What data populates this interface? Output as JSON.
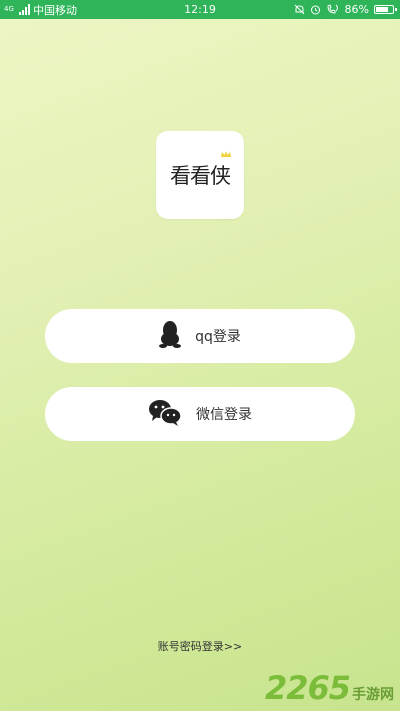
{
  "status_bar": {
    "signal_label": "4G",
    "carrier": "中国移动",
    "time": "12:19",
    "battery_percent": "86%",
    "battery_level": 0.86
  },
  "app": {
    "logo_text": "看看侠"
  },
  "buttons": {
    "qq_label": "qq登录",
    "wechat_label": "微信登录"
  },
  "account_login_label": "账号密码登录>>",
  "watermark": {
    "number": "2265",
    "site": "手游网"
  },
  "colors": {
    "status_bar": "#2fb45a",
    "button_bg": "#ffffff"
  }
}
